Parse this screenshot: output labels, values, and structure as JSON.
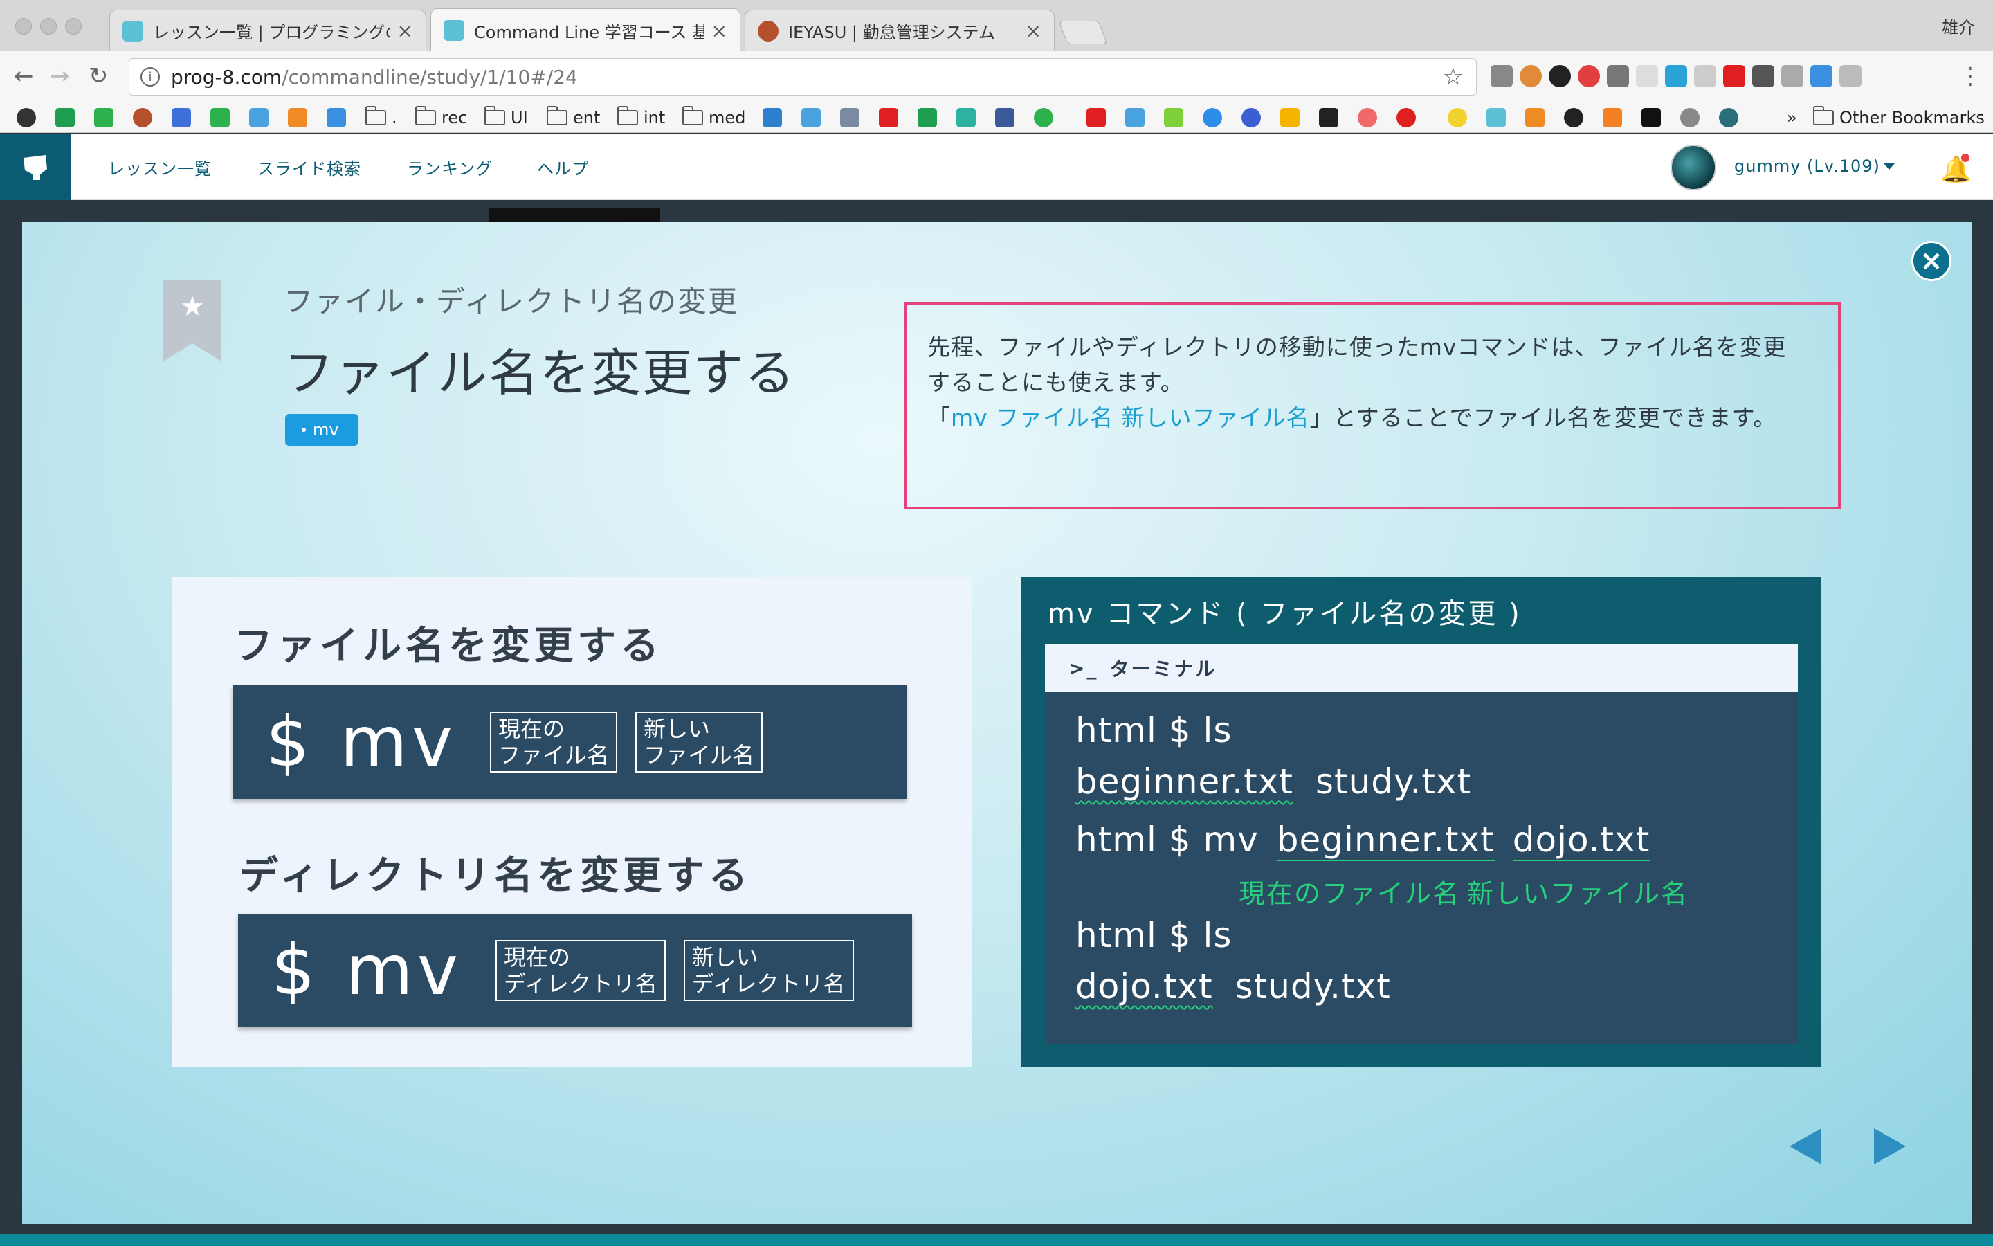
{
  "browser": {
    "tabs": [
      {
        "label": "レッスン一覧 | プログラミングの入",
        "close": "×",
        "favicon_color": "#5cc0d6"
      },
      {
        "label": "Command Line 学習コース 基礎",
        "close": "×",
        "favicon_color": "#5cc0d6"
      },
      {
        "label": "IEYASU | 勤怠管理システム",
        "close": "×",
        "favicon_color": "#b4512c"
      }
    ],
    "profile_name": "雄介",
    "url_domain": "prog-8.com",
    "url_path": "/commandline/study/1/10#/24",
    "star": "☆",
    "nav": {
      "back": "←",
      "forward": "→",
      "reload": "↻",
      "menu": "⋮"
    },
    "bookmarks": [
      ".",
      "rec",
      "UI",
      "ent",
      "int",
      "med"
    ],
    "overflow": "»",
    "other_bookmarks": "Other Bookmarks"
  },
  "site": {
    "nav": [
      "レッスン一覧",
      "スライド検索",
      "ランキング",
      "ヘルプ"
    ],
    "user": "gummy (Lv.109)",
    "bell": "🔔"
  },
  "slide": {
    "close": "×",
    "bookmark_star": "★",
    "subtitle": "ファイル・ディレクトリ名の変更",
    "title": "ファイル名を変更する",
    "tag": "mv",
    "description": {
      "part1": "先程、ファイルやディレクトリの移動に使ったmvコマンドは、ファイル名を変更することにも使えます。",
      "bracket_open": "「",
      "highlight": "mv ファイル名 新しいファイル名",
      "part2": "」とすることでファイル名を変更できます。"
    },
    "left_panel": {
      "file_heading": "ファイル名を変更する",
      "file_cmd": "$ mv",
      "file_arg1": [
        "現在の",
        "ファイル名"
      ],
      "file_arg2": [
        "新しい",
        "ファイル名"
      ],
      "dir_heading": "ディレクトリ名を変更する",
      "dir_cmd": "$ mv",
      "dir_arg1": [
        "現在の",
        "ディレクトリ名"
      ],
      "dir_arg2": [
        "新しい",
        "ディレクトリ名"
      ]
    },
    "right_panel": {
      "title": "mv コマンド ( ファイル名の変更 )",
      "terminal_label": "ターミナル",
      "terminal_icon": ">_",
      "lines": {
        "l1": "html $ ls",
        "l2a": "beginner.txt",
        "l2b": "study.txt",
        "l3a": "html $ mv",
        "l3b": "beginner.txt",
        "l3c": "dojo.txt",
        "note_current": "現在のファイル名",
        "note_new": "新しいファイル名",
        "l4": "html $ ls",
        "l5a": "dojo.txt",
        "l5b": "study.txt"
      }
    },
    "nav": {
      "prev": "◀",
      "next": "▶"
    }
  },
  "colors": {
    "site_primary": "#0b5b73",
    "highlight_blue": "#1b9fd0",
    "box_border_pink": "#e6427a",
    "terminal_bg": "#2b4a63",
    "terminal_green": "#27d07a"
  }
}
